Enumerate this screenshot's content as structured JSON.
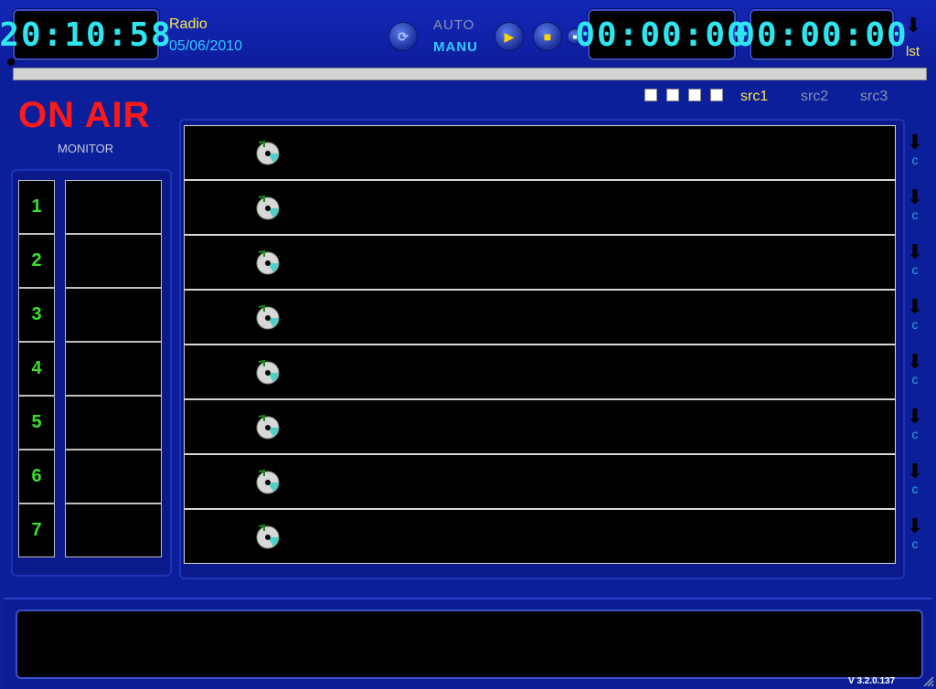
{
  "header": {
    "clock": "20:10:58",
    "station": "Radio",
    "date": "05/06/2010",
    "mode_auto": "AUTO",
    "mode_manu": "MANU",
    "timer1": "00:00:00",
    "timer2": "00:00:00",
    "lst_label": "lst",
    "lst_arrow": "⬇",
    "refresh_glyph": "⟳",
    "play_glyph": "▶",
    "stop_glyph": "■",
    "small_glyph": "■"
  },
  "on_air": {
    "title": "ON AIR",
    "subtitle": "MONITOR"
  },
  "sources": [
    "src1",
    "src2",
    "src3"
  ],
  "monitor_rows": [
    "1",
    "2",
    "3",
    "4",
    "5",
    "6",
    "7"
  ],
  "playlist_side_arrow": "⬇",
  "playlist_side_label": "c",
  "footer": {
    "version": "V 3.2.0.137"
  },
  "colors": {
    "accent": "#2ee6f0",
    "onair": "#ff1a1a",
    "active_src": "#ffe84a",
    "inactive_src": "#8a93b8",
    "numbers": "#39e029"
  }
}
